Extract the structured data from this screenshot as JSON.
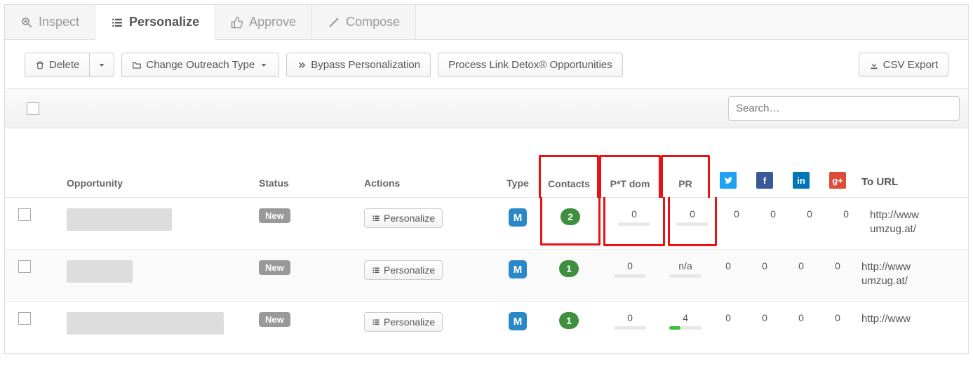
{
  "tabs": {
    "inspect": "Inspect",
    "personalize": "Personalize",
    "approve": "Approve",
    "compose": "Compose"
  },
  "toolbar": {
    "delete": "Delete",
    "change_outreach": "Change Outreach Type",
    "bypass": "Bypass Personalization",
    "process": "Process Link Detox® Opportunities",
    "export": "CSV Export"
  },
  "search": {
    "placeholder": "Search…"
  },
  "columns": {
    "opportunity": "Opportunity",
    "status": "Status",
    "actions": "Actions",
    "type": "Type",
    "contacts": "Contacts",
    "ptdom": "P*T dom",
    "pr": "PR",
    "to_url": "To URL"
  },
  "rows": [
    {
      "status": "New",
      "action": "Personalize",
      "type": "M",
      "contacts": "2",
      "ptdom": "0",
      "ptdom_fill": 0,
      "pr": "0",
      "pr_fill": 0,
      "tw": "0",
      "fb": "0",
      "in": "0",
      "gp": "0",
      "url": "http://www\numzug.at/",
      "thumb": "md",
      "highlight": true
    },
    {
      "status": "New",
      "action": "Personalize",
      "type": "M",
      "contacts": "1",
      "ptdom": "0",
      "ptdom_fill": 0,
      "pr": "n/a",
      "pr_fill": 0,
      "tw": "0",
      "fb": "0",
      "in": "0",
      "gp": "0",
      "url": "http://www\numzug.at/",
      "thumb": "sm",
      "highlight": false
    },
    {
      "status": "New",
      "action": "Personalize",
      "type": "M",
      "contacts": "1",
      "ptdom": "0",
      "ptdom_fill": 0,
      "pr": "4",
      "pr_fill": 35,
      "tw": "0",
      "fb": "0",
      "in": "0",
      "gp": "0",
      "url": "http://www",
      "thumb": "lg",
      "highlight": false
    }
  ],
  "icons": {
    "twitter": "t",
    "facebook": "f",
    "linkedin": "in",
    "gplus": "g+"
  }
}
